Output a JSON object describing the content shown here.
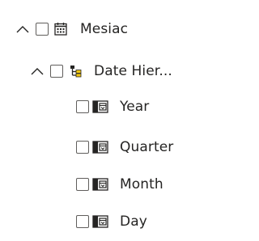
{
  "tree": {
    "table": {
      "label": "Mesiac",
      "expanded": true,
      "checked": false,
      "icon": "calendar-table-icon"
    },
    "hierarchy": {
      "label": "Date Hier...",
      "expanded": true,
      "checked": false,
      "icon": "hierarchy-icon"
    },
    "levels": [
      {
        "label": "Year",
        "checked": false,
        "icon": "date-level-icon"
      },
      {
        "label": "Quarter",
        "checked": false,
        "icon": "date-level-icon"
      },
      {
        "label": "Month",
        "checked": false,
        "icon": "date-level-icon"
      },
      {
        "label": "Day",
        "checked": false,
        "icon": "date-level-icon"
      }
    ]
  },
  "colors": {
    "text": "#252423",
    "checkbox_border": "#605e5c",
    "hierarchy_accent": "#f2c811"
  }
}
